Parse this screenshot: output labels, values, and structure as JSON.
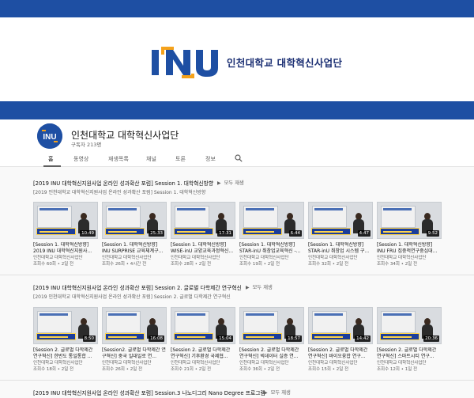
{
  "banner": {
    "logo_text": "인천대학교 대학혁신사업단",
    "logo_mark_name": "INU logo"
  },
  "channel": {
    "name": "인천대학교 대학혁신사업단",
    "subscribers": "구독자 213명"
  },
  "tabs": [
    {
      "label": "홈",
      "active": true
    },
    {
      "label": "동영상",
      "active": false
    },
    {
      "label": "재생목록",
      "active": false
    },
    {
      "label": "채널",
      "active": false
    },
    {
      "label": "토론",
      "active": false
    },
    {
      "label": "정보",
      "active": false
    }
  ],
  "play_all_label": "모두 재생",
  "sections": [
    {
      "title": "[2019 INU 대학혁신지원사업 온라인 성과확산 포럼] Session 1. 대학혁신방향",
      "subtitle": "[2019 인천대학교 대학혁신지원사업 온라인 성과확산 포럼] Session 1. 대학혁신방향",
      "videos": [
        {
          "title": "[Session 1. 대학혁신방향] 2019 INU 대학혁신지원사...",
          "channel": "인천대학교 대학혁신사업단",
          "meta": "조회수 60회 • 2일 전",
          "duration": "10:49"
        },
        {
          "title": "[Session 1. 대학혁신방향] INU SURPRISE 교육체계구...",
          "channel": "인천대학교 대학혁신사업단",
          "meta": "조회수 26회 • 4시간 전",
          "duration": "25:33"
        },
        {
          "title": "[Session 1. 대학혁신방향] WISE-inU 교양교육과정혁신...",
          "channel": "인천대학교 대학혁신사업단",
          "meta": "조회수 28회 • 2일 전",
          "duration": "17:31"
        },
        {
          "title": "[Session 1. 대학혁신방향] STAR-inU 취창업교육혁신 -...",
          "channel": "인천대학교 대학혁신사업단",
          "meta": "조회수 19회 • 2일 전",
          "duration": "6:44"
        },
        {
          "title": "[Session 1. 대학혁신방향] STAR-inU 취창업 시스템 구...",
          "channel": "인천대학교 대학혁신사업단",
          "meta": "조회수 32회 • 2일 전",
          "duration": "4:47"
        },
        {
          "title": "[Session 1. 대학혁신방향] INU FRU 집중적연구중심대...",
          "channel": "인천대학교 대학혁신사업단",
          "meta": "조회수 34회 • 2일 전",
          "duration": "9:52"
        }
      ]
    },
    {
      "title": "[2019 INU 대학혁신지원사업 온라인 성과확산 포럼] Session 2. 글로벌 다학제간 연구혁신",
      "subtitle": "[2019 인천대학교 대학혁신지원사업 온라인 성과확산 포럼] Session 2. 글로벌 다학제간 연구혁신",
      "videos": [
        {
          "title": "[Session 2. 글로벌 다학제간 연구혁신] 한반도 통일통합 ...",
          "channel": "인천대학교 대학혁신사업단",
          "meta": "조회수 18회 • 2일 전",
          "duration": "8:50"
        },
        {
          "title": "[Session2. 글로벌 다학제간 연구혁신] 중국 일대일로 연...",
          "channel": "인천대학교 대학혁신사업단",
          "meta": "조회수 26회 • 2일 전",
          "duration": "16:08"
        },
        {
          "title": "[Session 2. 글로벌 다학제간 연구혁신] 기후환경 국제협...",
          "channel": "인천대학교 대학혁신사업단",
          "meta": "조회수 21회 • 2일 전",
          "duration": "15:04"
        },
        {
          "title": "[Session 2. 글로벌 다학제간 연구혁신] 빅데이터 실증 연...",
          "channel": "인천대학교 대학혁신사업단",
          "meta": "조회수 36회 • 2일 전",
          "duration": "18:57"
        },
        {
          "title": "[Session 2. 글로벌 다학제간 연구혁신] 바이오융합 연구...",
          "channel": "인천대학교 대학혁신사업단",
          "meta": "조회수 15회 • 2일 전",
          "duration": "14:42"
        },
        {
          "title": "[Session 2. 글로벌 다학제간 연구혁신] 스마트시티 연구...",
          "channel": "인천대학교 대학혁신사업단",
          "meta": "조회수 12회 • 1일 전",
          "duration": "20:36"
        }
      ]
    },
    {
      "title": "[2019 INU 대학혁신지원사업 온라인 성과확산 포럼] Session.3 나노디그리 Nano Degree 프로그램",
      "subtitle": "",
      "videos": []
    }
  ],
  "colors": {
    "brand_blue": "#1e4fa3",
    "logo_orange": "#f5a21b",
    "caption_yellow": "#ffd54a"
  }
}
